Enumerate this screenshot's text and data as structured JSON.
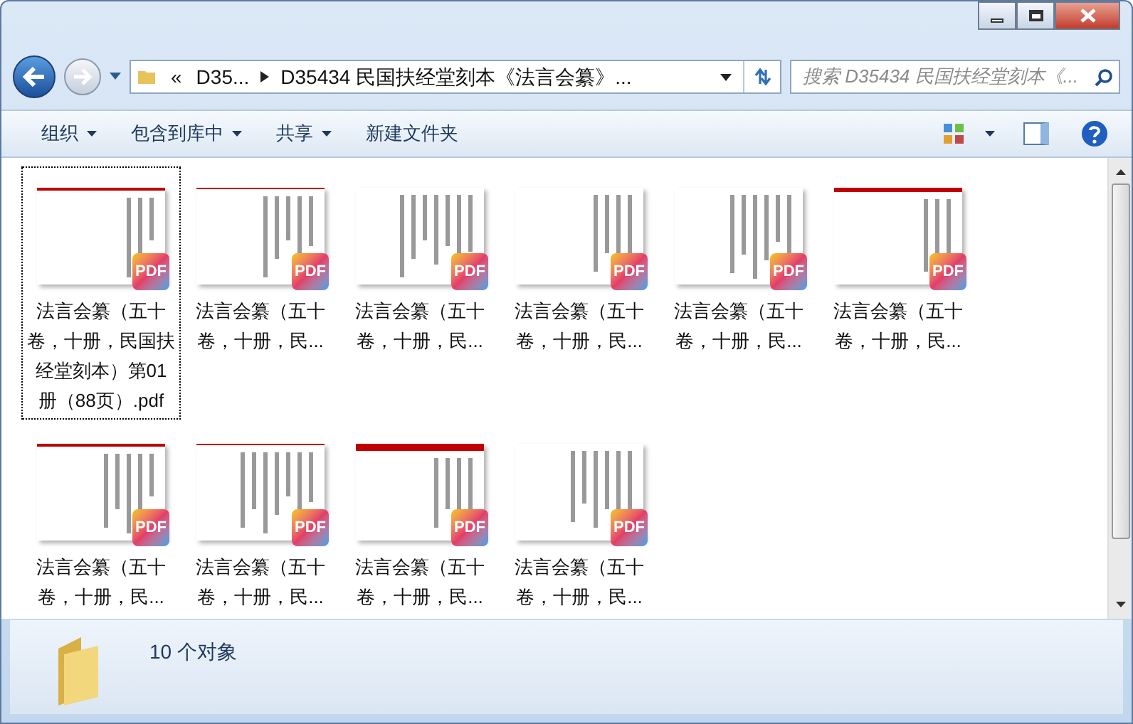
{
  "address_bar": {
    "overflow": "«",
    "crumbs": [
      "D35...",
      "D35434 民国扶经堂刻本《法言会纂》..."
    ]
  },
  "search": {
    "placeholder": "搜索 D35434 民国扶经堂刻本《..."
  },
  "toolbar": {
    "items": [
      {
        "label": "组织",
        "dropdown": true
      },
      {
        "label": "包含到库中",
        "dropdown": true
      },
      {
        "label": "共享",
        "dropdown": true
      },
      {
        "label": "新建文件夹",
        "dropdown": false
      }
    ]
  },
  "files": [
    {
      "name": "法言会纂（五十卷，十册，民国扶经堂刻本）第01册（88页）.pdf",
      "badge": "PDF",
      "selected": true
    },
    {
      "name": "法言会纂（五十卷，十册，民...",
      "badge": "PDF",
      "selected": false
    },
    {
      "name": "法言会纂（五十卷，十册，民...",
      "badge": "PDF",
      "selected": false
    },
    {
      "name": "法言会纂（五十卷，十册，民...",
      "badge": "PDF",
      "selected": false
    },
    {
      "name": "法言会纂（五十卷，十册，民...",
      "badge": "PDF",
      "selected": false
    },
    {
      "name": "法言会纂（五十卷，十册，民...",
      "badge": "PDF",
      "selected": false
    },
    {
      "name": "法言会纂（五十卷，十册，民...",
      "badge": "PDF",
      "selected": false
    },
    {
      "name": "法言会纂（五十卷，十册，民...",
      "badge": "PDF",
      "selected": false
    },
    {
      "name": "法言会纂（五十卷，十册，民...",
      "badge": "PDF",
      "selected": false
    },
    {
      "name": "法言会纂（五十卷，十册，民...",
      "badge": "PDF",
      "selected": false
    }
  ],
  "status_bar": {
    "count": "10 个对象"
  }
}
